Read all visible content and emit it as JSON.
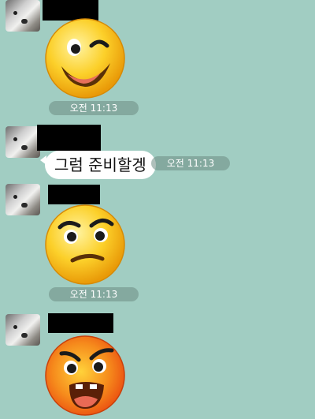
{
  "chat": {
    "messages": [
      {
        "type": "emoticon",
        "emoticon": "winking-face",
        "time": "오전 11:13"
      },
      {
        "type": "text",
        "text": "그럼 준비할겡",
        "time": "오전 11:13"
      },
      {
        "type": "emoticon",
        "emoticon": "annoyed-face",
        "time": "오전 11:13"
      },
      {
        "type": "emoticon",
        "emoticon": "angry-shouting-face"
      }
    ]
  },
  "colors": {
    "background": "#a1cdc2",
    "bubble": "#ffffff",
    "emoji_yellow": "#f9c21a",
    "emoji_red": "#f05a1c"
  }
}
